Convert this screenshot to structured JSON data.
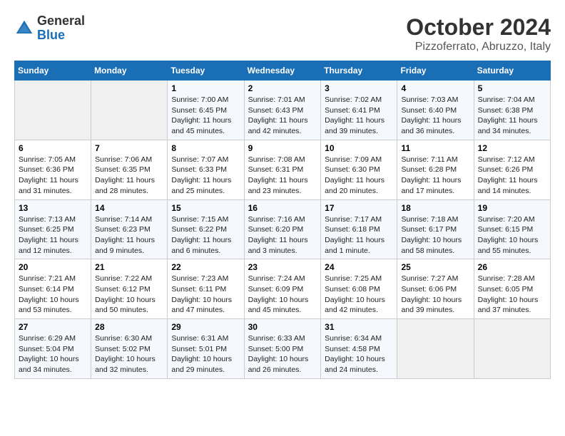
{
  "header": {
    "logo_line1": "General",
    "logo_line2": "Blue",
    "title": "October 2024",
    "location": "Pizzoferrato, Abruzzo, Italy"
  },
  "weekdays": [
    "Sunday",
    "Monday",
    "Tuesday",
    "Wednesday",
    "Thursday",
    "Friday",
    "Saturday"
  ],
  "weeks": [
    [
      {
        "day": "",
        "info": ""
      },
      {
        "day": "",
        "info": ""
      },
      {
        "day": "1",
        "info": "Sunrise: 7:00 AM\nSunset: 6:45 PM\nDaylight: 11 hours and 45 minutes."
      },
      {
        "day": "2",
        "info": "Sunrise: 7:01 AM\nSunset: 6:43 PM\nDaylight: 11 hours and 42 minutes."
      },
      {
        "day": "3",
        "info": "Sunrise: 7:02 AM\nSunset: 6:41 PM\nDaylight: 11 hours and 39 minutes."
      },
      {
        "day": "4",
        "info": "Sunrise: 7:03 AM\nSunset: 6:40 PM\nDaylight: 11 hours and 36 minutes."
      },
      {
        "day": "5",
        "info": "Sunrise: 7:04 AM\nSunset: 6:38 PM\nDaylight: 11 hours and 34 minutes."
      }
    ],
    [
      {
        "day": "6",
        "info": "Sunrise: 7:05 AM\nSunset: 6:36 PM\nDaylight: 11 hours and 31 minutes."
      },
      {
        "day": "7",
        "info": "Sunrise: 7:06 AM\nSunset: 6:35 PM\nDaylight: 11 hours and 28 minutes."
      },
      {
        "day": "8",
        "info": "Sunrise: 7:07 AM\nSunset: 6:33 PM\nDaylight: 11 hours and 25 minutes."
      },
      {
        "day": "9",
        "info": "Sunrise: 7:08 AM\nSunset: 6:31 PM\nDaylight: 11 hours and 23 minutes."
      },
      {
        "day": "10",
        "info": "Sunrise: 7:09 AM\nSunset: 6:30 PM\nDaylight: 11 hours and 20 minutes."
      },
      {
        "day": "11",
        "info": "Sunrise: 7:11 AM\nSunset: 6:28 PM\nDaylight: 11 hours and 17 minutes."
      },
      {
        "day": "12",
        "info": "Sunrise: 7:12 AM\nSunset: 6:26 PM\nDaylight: 11 hours and 14 minutes."
      }
    ],
    [
      {
        "day": "13",
        "info": "Sunrise: 7:13 AM\nSunset: 6:25 PM\nDaylight: 11 hours and 12 minutes."
      },
      {
        "day": "14",
        "info": "Sunrise: 7:14 AM\nSunset: 6:23 PM\nDaylight: 11 hours and 9 minutes."
      },
      {
        "day": "15",
        "info": "Sunrise: 7:15 AM\nSunset: 6:22 PM\nDaylight: 11 hours and 6 minutes."
      },
      {
        "day": "16",
        "info": "Sunrise: 7:16 AM\nSunset: 6:20 PM\nDaylight: 11 hours and 3 minutes."
      },
      {
        "day": "17",
        "info": "Sunrise: 7:17 AM\nSunset: 6:18 PM\nDaylight: 11 hours and 1 minute."
      },
      {
        "day": "18",
        "info": "Sunrise: 7:18 AM\nSunset: 6:17 PM\nDaylight: 10 hours and 58 minutes."
      },
      {
        "day": "19",
        "info": "Sunrise: 7:20 AM\nSunset: 6:15 PM\nDaylight: 10 hours and 55 minutes."
      }
    ],
    [
      {
        "day": "20",
        "info": "Sunrise: 7:21 AM\nSunset: 6:14 PM\nDaylight: 10 hours and 53 minutes."
      },
      {
        "day": "21",
        "info": "Sunrise: 7:22 AM\nSunset: 6:12 PM\nDaylight: 10 hours and 50 minutes."
      },
      {
        "day": "22",
        "info": "Sunrise: 7:23 AM\nSunset: 6:11 PM\nDaylight: 10 hours and 47 minutes."
      },
      {
        "day": "23",
        "info": "Sunrise: 7:24 AM\nSunset: 6:09 PM\nDaylight: 10 hours and 45 minutes."
      },
      {
        "day": "24",
        "info": "Sunrise: 7:25 AM\nSunset: 6:08 PM\nDaylight: 10 hours and 42 minutes."
      },
      {
        "day": "25",
        "info": "Sunrise: 7:27 AM\nSunset: 6:06 PM\nDaylight: 10 hours and 39 minutes."
      },
      {
        "day": "26",
        "info": "Sunrise: 7:28 AM\nSunset: 6:05 PM\nDaylight: 10 hours and 37 minutes."
      }
    ],
    [
      {
        "day": "27",
        "info": "Sunrise: 6:29 AM\nSunset: 5:04 PM\nDaylight: 10 hours and 34 minutes."
      },
      {
        "day": "28",
        "info": "Sunrise: 6:30 AM\nSunset: 5:02 PM\nDaylight: 10 hours and 32 minutes."
      },
      {
        "day": "29",
        "info": "Sunrise: 6:31 AM\nSunset: 5:01 PM\nDaylight: 10 hours and 29 minutes."
      },
      {
        "day": "30",
        "info": "Sunrise: 6:33 AM\nSunset: 5:00 PM\nDaylight: 10 hours and 26 minutes."
      },
      {
        "day": "31",
        "info": "Sunrise: 6:34 AM\nSunset: 4:58 PM\nDaylight: 10 hours and 24 minutes."
      },
      {
        "day": "",
        "info": ""
      },
      {
        "day": "",
        "info": ""
      }
    ]
  ]
}
